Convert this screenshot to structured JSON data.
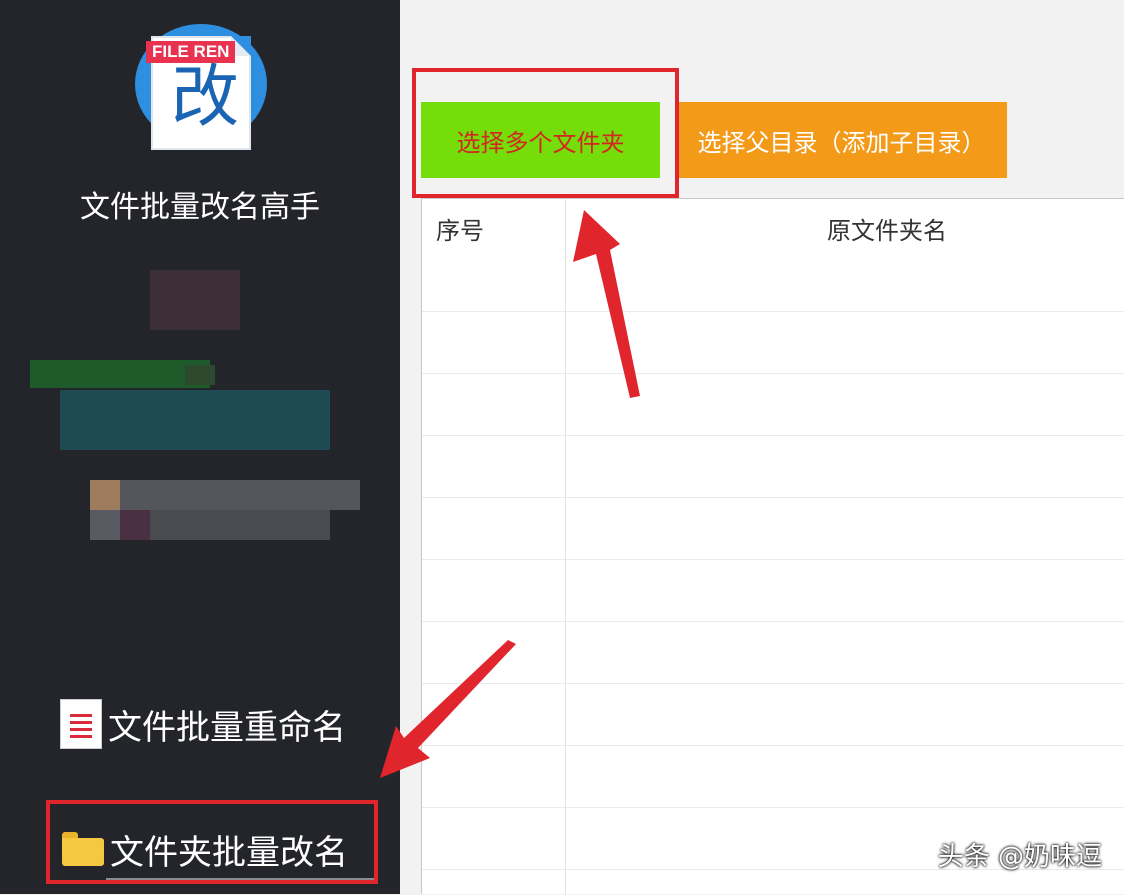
{
  "sidebar": {
    "logo_tag": "FILE REN",
    "logo_char": "改",
    "app_name": "文件批量改名高手",
    "nav": [
      {
        "label": "文件批量重命名",
        "icon": "document-icon"
      },
      {
        "label": "文件夹批量改名",
        "icon": "folder-icon"
      }
    ]
  },
  "toolbar": {
    "select_multiple_label": "选择多个文件夹",
    "select_parent_label": "选择父目录（添加子目录）"
  },
  "table": {
    "columns": [
      "序号",
      "原文件夹名"
    ],
    "rows": []
  },
  "watermark": "头条 @奶味逗",
  "colors": {
    "sidebar_bg": "#23252b",
    "green_button": "#74dd0a",
    "orange_button": "#f39a18",
    "highlight_red": "#e0262c"
  }
}
